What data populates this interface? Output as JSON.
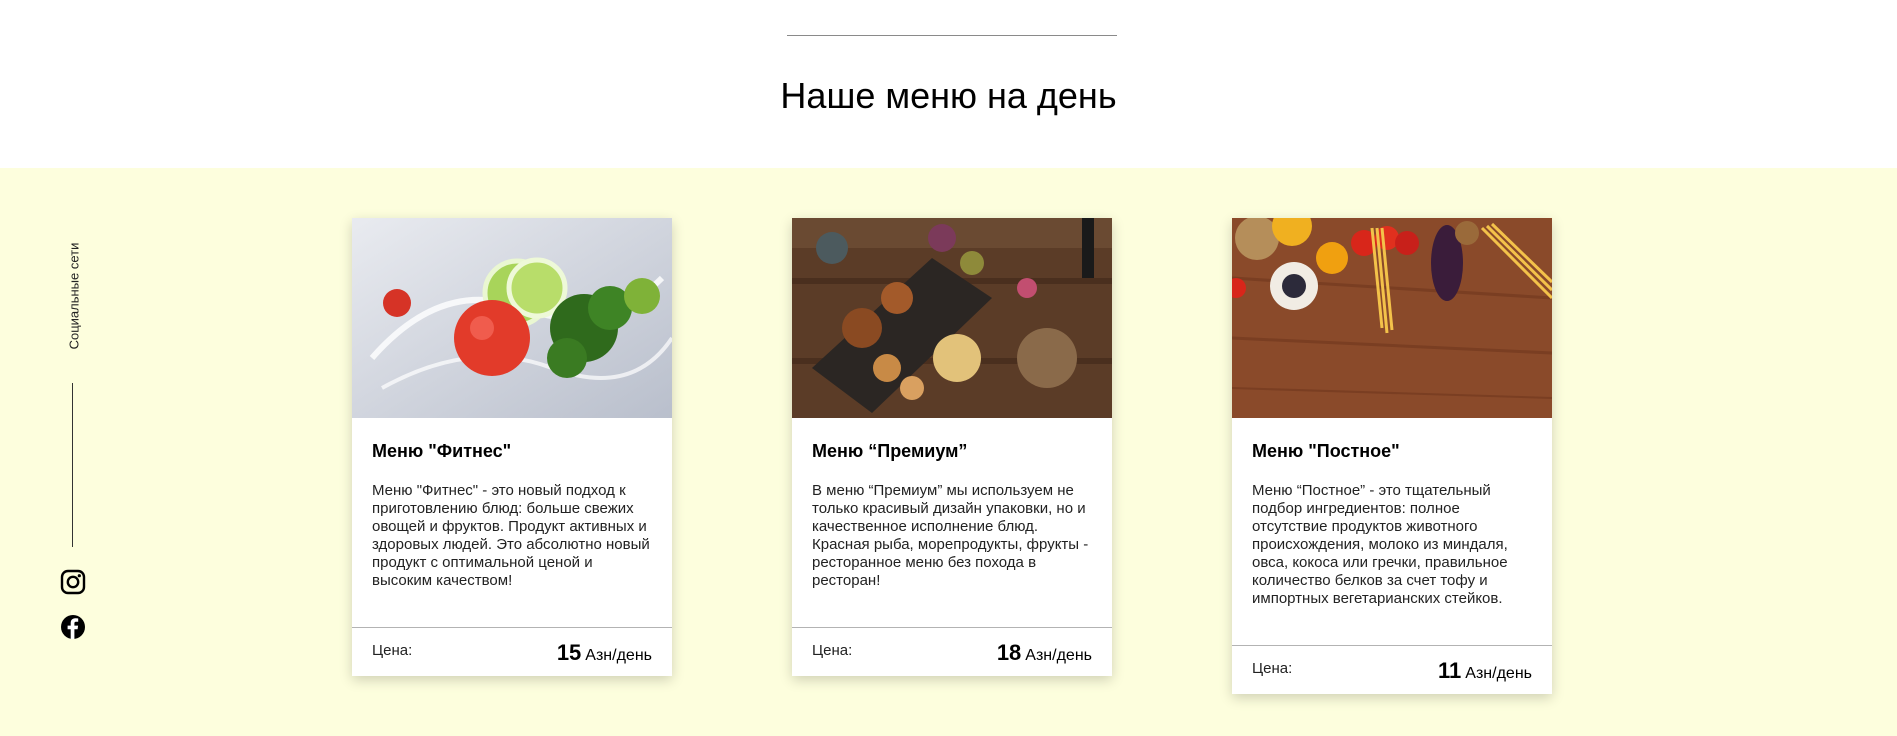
{
  "section": {
    "title": "Наше меню на день"
  },
  "social": {
    "label": "Социальные сети",
    "icons": [
      "instagram-icon",
      "facebook-icon"
    ]
  },
  "cards": [
    {
      "name": "Меню \"Фитнес\"",
      "description": "Меню \"Фитнес\" - это новый подход к приготовлению блюд: больше свежих овощей и фруктов. Продукт активных и здоровых людей. Это абсолютно новый продукт с оптимальной ценой и высоким качеством!",
      "price_label": "Цена:",
      "price": "15",
      "unit": "Азн/день"
    },
    {
      "name": "Меню “Премиум”",
      "description": "В меню “Премиум” мы используем не только красивый дизайн упаковки, но и качественное исполнение блюд. Красная рыба, морепродукты, фрукты - ресторанное меню без похода в ресторан!",
      "price_label": "Цена:",
      "price": "18",
      "unit": "Азн/день"
    },
    {
      "name": "Меню \"Постное\"",
      "description": "Меню “Постное” - это тщательный подбор ингредиентов: полное отсутствие продуктов животного происхождения, молоко из миндаля, овса, кокоса или гречки, правильное количество белков за счет тофу и импортных вегетарианских стейков.",
      "price_label": "Цена:",
      "price": "11",
      "unit": "Азн/день"
    }
  ],
  "colors": {
    "band_background": "#fdfedd",
    "card_background": "#ffffff",
    "text": "#000000"
  }
}
